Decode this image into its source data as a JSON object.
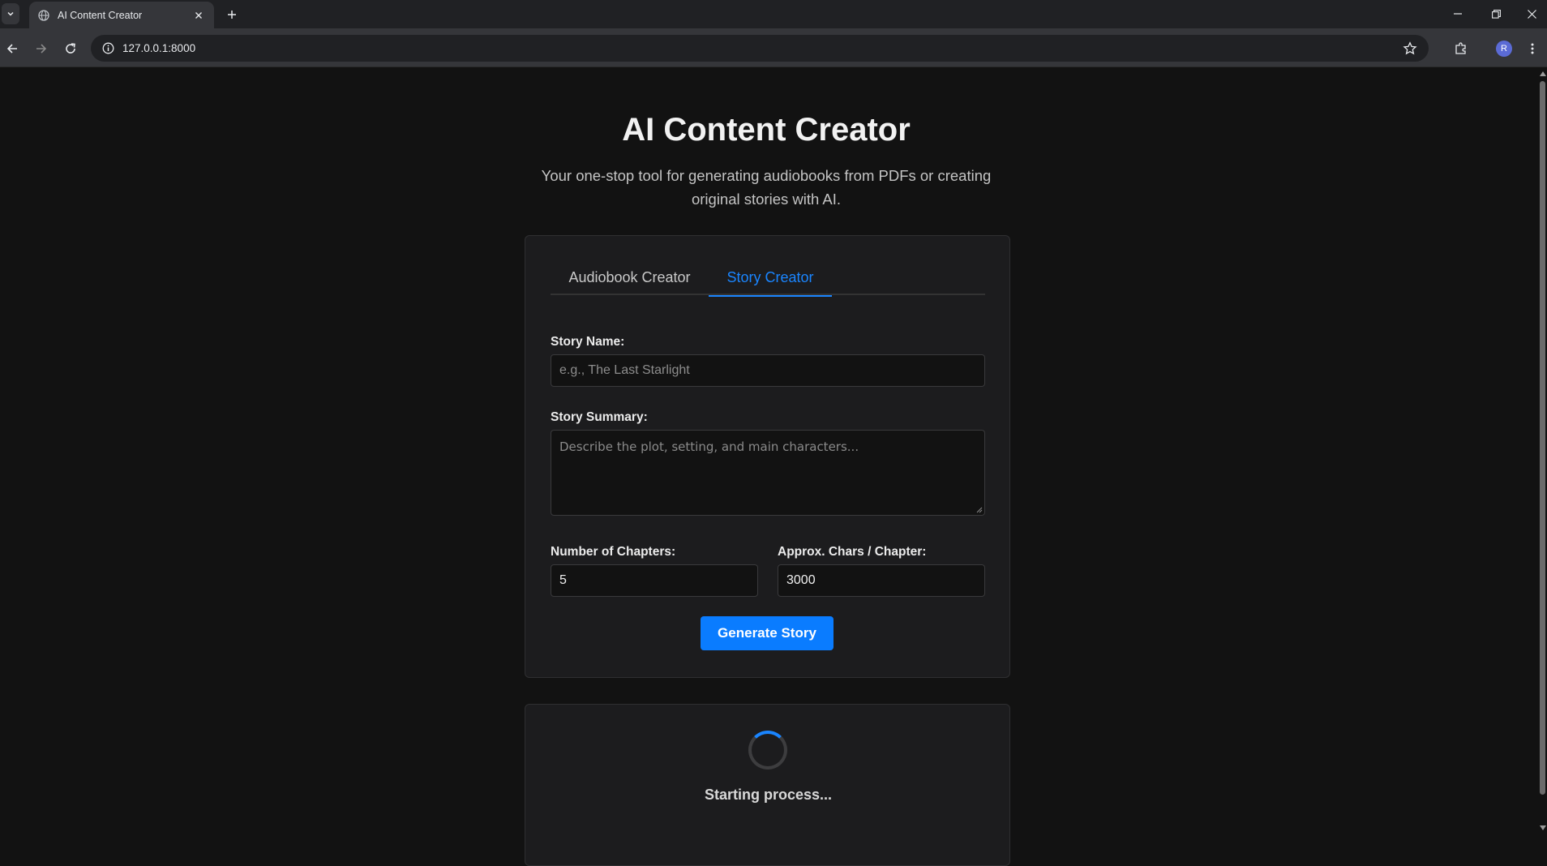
{
  "browser": {
    "tab_title": "AI Content Creator",
    "url": "127.0.0.1:8000",
    "profile_initial": "R"
  },
  "header": {
    "title": "AI Content Creator",
    "subtitle": "Your one-stop tool for generating audiobooks from PDFs or creating original stories with AI."
  },
  "tabs": [
    {
      "label": "Audiobook Creator",
      "active": false
    },
    {
      "label": "Story Creator",
      "active": true
    }
  ],
  "form": {
    "story_name_label": "Story Name:",
    "story_name_placeholder": "e.g., The Last Starlight",
    "story_name_value": "",
    "summary_label": "Story Summary:",
    "summary_placeholder": "Describe the plot, setting, and main characters...",
    "chapters_label": "Number of Chapters:",
    "chapters_value": "5",
    "chars_label": "Approx. Chars / Chapter:",
    "chars_value": "3000",
    "submit_label": "Generate Story"
  },
  "status": {
    "message": "Starting process..."
  },
  "colors": {
    "accent": "#0a7cff",
    "background": "#121212",
    "card": "#1c1c1e"
  }
}
